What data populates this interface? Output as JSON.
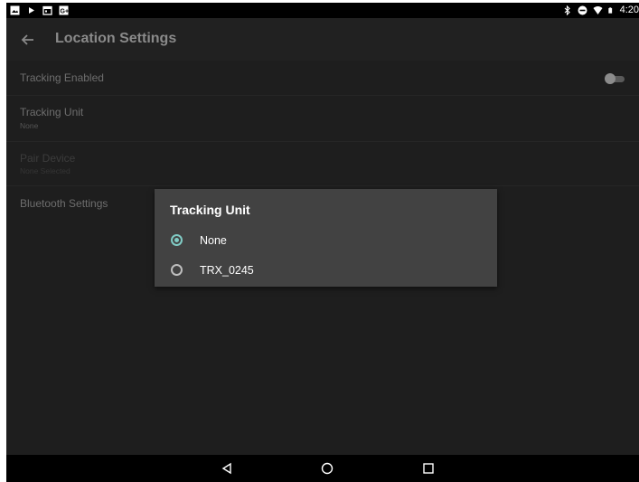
{
  "status_bar": {
    "time": "4:20",
    "left_icons": [
      "image-icon",
      "play-store-icon",
      "calendar-icon",
      "google-plus-icon"
    ],
    "right_icons": [
      "bluetooth-icon",
      "do-not-disturb-icon",
      "wifi-icon",
      "battery-icon"
    ]
  },
  "app_bar": {
    "title": "Location Settings",
    "back_icon": "back-arrow-icon"
  },
  "settings": {
    "tracking_enabled": {
      "label": "Tracking Enabled",
      "checked": false
    },
    "tracking_unit": {
      "label": "Tracking Unit",
      "value": "None"
    },
    "pair_device": {
      "label": "Pair Device",
      "value": "None Selected"
    },
    "bluetooth_settings": {
      "label": "Bluetooth Settings"
    }
  },
  "dialog": {
    "title": "Tracking Unit",
    "options": [
      {
        "label": "None",
        "selected": true
      },
      {
        "label": "TRX_0245",
        "selected": false
      }
    ]
  },
  "nav_bar": {
    "buttons": [
      "back-icon",
      "home-icon",
      "recents-icon"
    ]
  },
  "colors": {
    "accent": "#80cbc4",
    "dialog_bg": "#424242",
    "screen_bg": "#1e1e1e"
  }
}
